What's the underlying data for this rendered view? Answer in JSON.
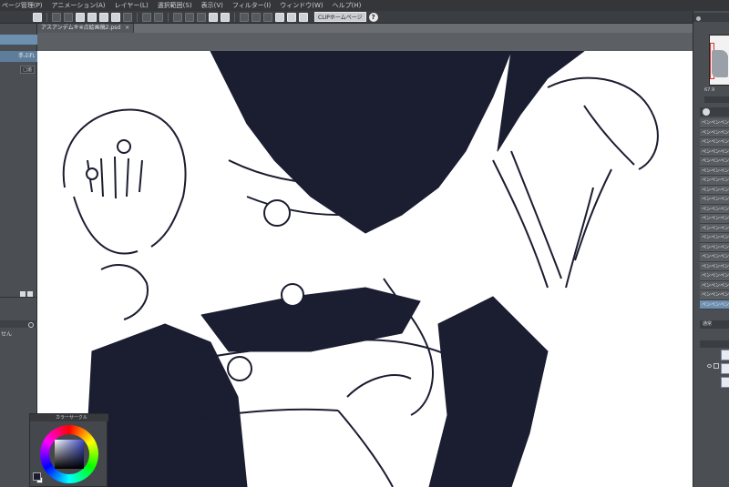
{
  "menu": {
    "items": [
      "ページ管理(P)",
      "アニメーション(A)",
      "レイヤー(L)",
      "選択範囲(S)",
      "表示(V)",
      "フィルター(I)",
      "ウィンドウ(W)",
      "ヘルプ(H)"
    ]
  },
  "command_bar": {
    "home_label": "CLIPホームページ",
    "help_label": "?"
  },
  "document": {
    "tab_title": "アスアンデムキ※点絵画稿2.psd",
    "close_label": "×"
  },
  "left_panel": {
    "sub_tool_label": "手ぶれ",
    "button_label": "□追",
    "status_text": "せん"
  },
  "color_panel": {
    "title": "カラーサークル",
    "colors": {
      "main": "#1a1b2e",
      "sub": "#ffffff"
    }
  },
  "right_panel": {
    "readout": "67.9",
    "layers": [
      "ペンペンペン",
      "ペンペンペン",
      "ペンペンペン",
      "ペンペンペン",
      "ペンペンペン",
      "ペンペンペン",
      "ペンペンペン",
      "ペンペンペン",
      "ペンペンペン",
      "ペンペンペン",
      "ペンペンペン",
      "ペンペンペン",
      "ペンペンペン",
      "ペンペンペン",
      "ペンペンペン",
      "ペンペンペン",
      "ペンペンペン",
      "ペンペンペン",
      "ペンペンペン",
      "ペンペンペン"
    ],
    "selected_layer_index": 19,
    "blend_mode": "通常"
  },
  "colors": {
    "accent": "#6d8fb0",
    "ink": "#1b1d30",
    "chrome": "#4b4f54"
  }
}
